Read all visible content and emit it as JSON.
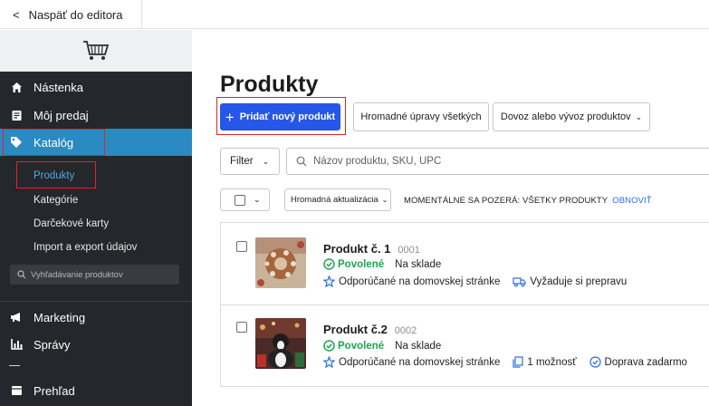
{
  "topbar": {
    "back_label": "Naspäť do editora"
  },
  "sidebar": {
    "nav": [
      {
        "label": "Nástenka",
        "icon": "home-icon"
      },
      {
        "label": "Môj predaj",
        "icon": "receipt-icon"
      },
      {
        "label": "Katalóg",
        "icon": "tag-icon"
      }
    ],
    "catalog_sub": [
      "Produkty",
      "Kategórie",
      "Darčekové karty",
      "Import a export údajov"
    ],
    "search_placeholder": "Vyhľadávanie produktov",
    "nav_bottom": [
      {
        "label": "Marketing",
        "icon": "megaphone-icon"
      },
      {
        "label": "Správy",
        "icon": "bar-chart-icon"
      },
      {
        "label": "Prehľad",
        "icon": "overview-icon"
      }
    ]
  },
  "main": {
    "title": "Produkty",
    "add_button": "Pridať nový produkt",
    "bulk_edit_button": "Hromadné úpravy všetkých",
    "import_export_button": "Dovoz alebo vývoz produktov",
    "filter_label": "Filter",
    "search_placeholder": "Názov produktu, SKU, UPC",
    "bulk_update_label": "Hromadná aktualizácia",
    "viewing_text": "MOMENTÁLNE SA POZERÁ: VŠETKY PRODUKTY",
    "refresh_label": "OBNOVIŤ"
  },
  "products": [
    {
      "name": "Produkt č. 1",
      "id": "0001",
      "status": "Povolené",
      "stock": "Na sklade",
      "tags": [
        "Odporúčané na domovskej stránke",
        "Vyžaduje si prepravu"
      ]
    },
    {
      "name": "Produkt č.2",
      "id": "0002",
      "status": "Povolené",
      "stock": "Na sklade",
      "tags": [
        "Odporúčané na domovskej stránke",
        "1 možnosť",
        "Doprava zadarmo"
      ]
    }
  ],
  "colors": {
    "sidebar_bg": "#24272b",
    "active_nav": "#2a8ac2",
    "primary_button": "#2657e8",
    "enabled_green": "#1da650",
    "link_blue": "#2a6fe0",
    "highlight_red": "#e0242b"
  }
}
